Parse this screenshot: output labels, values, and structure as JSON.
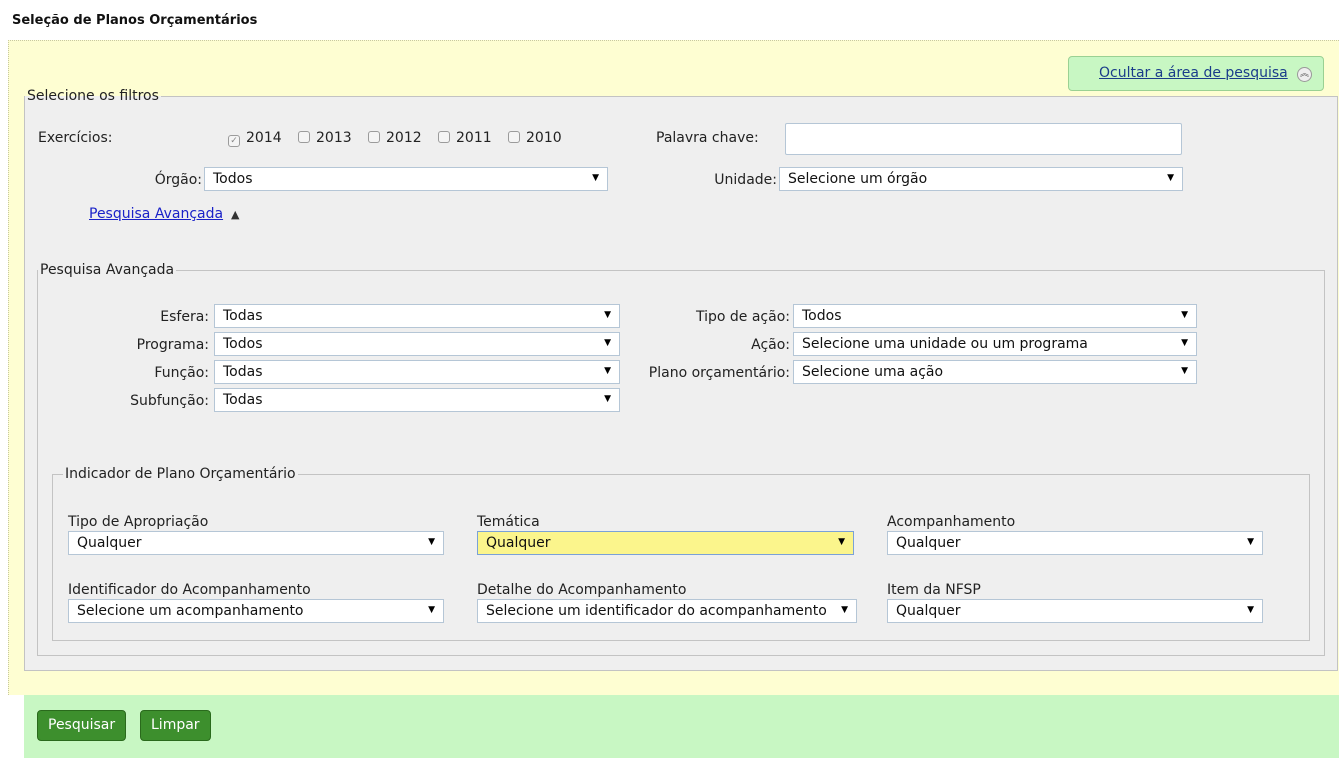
{
  "page": {
    "title": "Seleção de Planos Orçamentários"
  },
  "toggle": {
    "label": "Ocultar a área de pesquisa",
    "icon": "double-chevron-up-icon"
  },
  "filters": {
    "legend": "Selecione os filtros",
    "exercicios": {
      "label": "Exercícios:",
      "years": [
        {
          "label": "2014",
          "checked": true,
          "disabled": true
        },
        {
          "label": "2013",
          "checked": false
        },
        {
          "label": "2012",
          "checked": false
        },
        {
          "label": "2011",
          "checked": false
        },
        {
          "label": "2010",
          "checked": false
        }
      ]
    },
    "palavra_chave": {
      "label": "Palavra chave:",
      "value": ""
    },
    "orgao": {
      "label": "Órgão:",
      "value": "Todos"
    },
    "unidade": {
      "label": "Unidade:",
      "value": "Selecione um órgão"
    },
    "advanced_link": "Pesquisa Avançada"
  },
  "advanced": {
    "legend": "Pesquisa Avançada",
    "esfera": {
      "label": "Esfera:",
      "value": "Todas"
    },
    "programa": {
      "label": "Programa:",
      "value": "Todos"
    },
    "funcao": {
      "label": "Função:",
      "value": "Todas"
    },
    "subfuncao": {
      "label": "Subfunção:",
      "value": "Todas"
    },
    "tipo_acao": {
      "label": "Tipo de ação:",
      "value": "Todos"
    },
    "acao": {
      "label": "Ação:",
      "value": "Selecione uma unidade ou um programa"
    },
    "plano": {
      "label": "Plano orçamentário:",
      "value": "Selecione uma ação"
    }
  },
  "indicador": {
    "legend": "Indicador de Plano Orçamentário",
    "tipo_apropriacao": {
      "label": "Tipo de Apropriação",
      "value": "Qualquer"
    },
    "tematica": {
      "label": "Temática",
      "value": "Qualquer"
    },
    "acompanhamento": {
      "label": "Acompanhamento",
      "value": "Qualquer"
    },
    "identificador": {
      "label": "Identificador do Acompanhamento",
      "value": "Selecione um acompanhamento"
    },
    "detalhe": {
      "label": "Detalhe do Acompanhamento",
      "value": "Selecione um identificador do acompanhamento"
    },
    "item_nfsp": {
      "label": "Item da NFSP",
      "value": "Qualquer"
    }
  },
  "buttons": {
    "search": "Pesquisar",
    "clear": "Limpar"
  },
  "colors": {
    "panel_bg": "#fefed2",
    "action_bar": "#c8f7c3",
    "button_green": "#3d8f2d",
    "highlight_select": "#fbf58c"
  }
}
